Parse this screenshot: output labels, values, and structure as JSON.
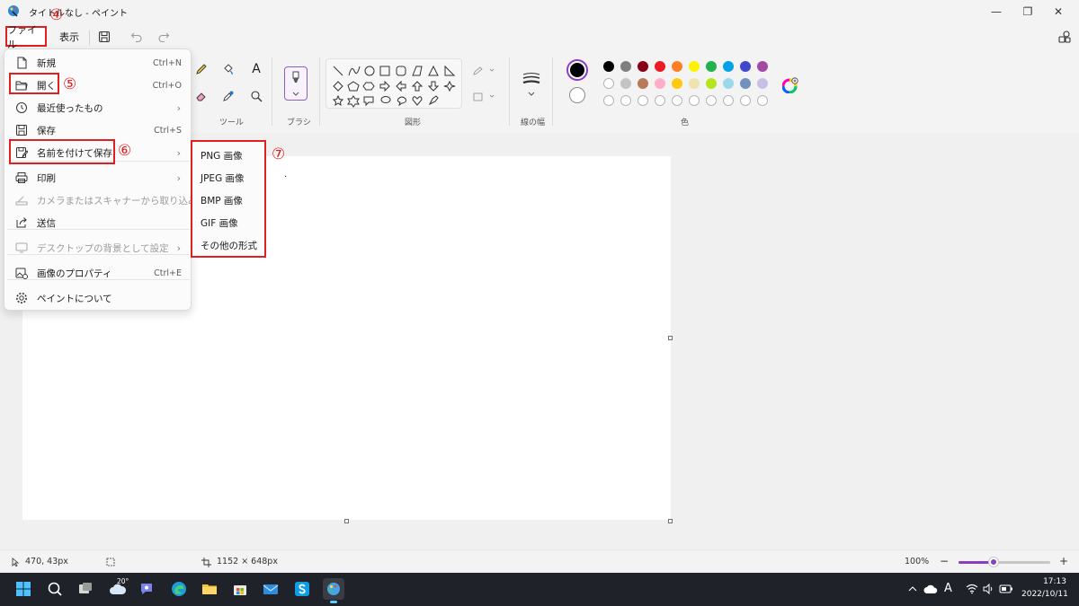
{
  "window": {
    "title": "タイトルなし - ペイント",
    "minimize_glyph": "—",
    "restore_glyph": "❐",
    "close_glyph": "✕"
  },
  "menubar": {
    "file_label": "ファイル",
    "view_label": "表示"
  },
  "callouts": [
    "④",
    "⑤",
    "⑥",
    "⑦"
  ],
  "ribbon": {
    "tools_label": "ツール",
    "brush_label": "ブラシ",
    "shapes_label": "図形",
    "line_width_label": "線の幅",
    "colors_label": "色",
    "text_tool_glyph": "A",
    "palette_row1": [
      "#000000",
      "#7f7f7f",
      "#880015",
      "#ed1c24",
      "#ff7f27",
      "#fff200",
      "#22b14c",
      "#00a2e8",
      "#3f48cc",
      "#a349a4"
    ],
    "palette_row2": [
      "",
      "#c3c3c3",
      "#b97a57",
      "#ffaec9",
      "#ffc90e",
      "#efe4b0",
      "#b5e61d",
      "#99d9ea",
      "#7092be",
      "#c8bfe7"
    ],
    "primary_color": "#000000",
    "secondary_color": "#ffffff"
  },
  "file_menu": {
    "items": [
      {
        "label": "新規",
        "shortcut": "Ctrl+N",
        "icon": "new-file-icon"
      },
      {
        "label": "開く",
        "shortcut": "Ctrl+O",
        "icon": "folder-open-icon"
      },
      {
        "label": "最近使ったもの",
        "shortcut": "",
        "icon": "recent-clock-icon",
        "chevron": "›"
      },
      {
        "label": "保存",
        "shortcut": "Ctrl+S",
        "icon": "save-icon"
      },
      {
        "label": "名前を付けて保存",
        "shortcut": "",
        "icon": "save-as-icon",
        "chevron": "›"
      },
      {
        "label": "印刷",
        "shortcut": "",
        "icon": "print-icon",
        "chevron": "›"
      },
      {
        "label": "カメラまたはスキャナーから取り込み",
        "shortcut": "",
        "icon": "scanner-icon",
        "disabled": true
      },
      {
        "label": "送信",
        "shortcut": "",
        "icon": "share-icon"
      },
      {
        "label": "デスクトップの背景として設定",
        "shortcut": "",
        "icon": "desktop-icon",
        "chevron": "›",
        "disabled": true
      },
      {
        "label": "画像のプロパティ",
        "shortcut": "Ctrl+E",
        "icon": "image-properties-icon"
      },
      {
        "label": "ペイントについて",
        "shortcut": "",
        "icon": "settings-gear-icon"
      }
    ]
  },
  "save_as_submenu": {
    "items": [
      "PNG 画像",
      "JPEG 画像",
      "BMP 画像",
      "GIF 画像",
      "その他の形式"
    ]
  },
  "canvas": {
    "stray_dot": "."
  },
  "status": {
    "cursor_position": "470, 43px",
    "canvas_size": "1152 × 648px",
    "zoom": "100%",
    "zoom_fraction": 0.38,
    "zoom_out": "−",
    "zoom_in": "+"
  },
  "taskbar": {
    "weather_temp": "20°",
    "time": "17:13",
    "date": "2022/10/11",
    "ime": "A"
  }
}
